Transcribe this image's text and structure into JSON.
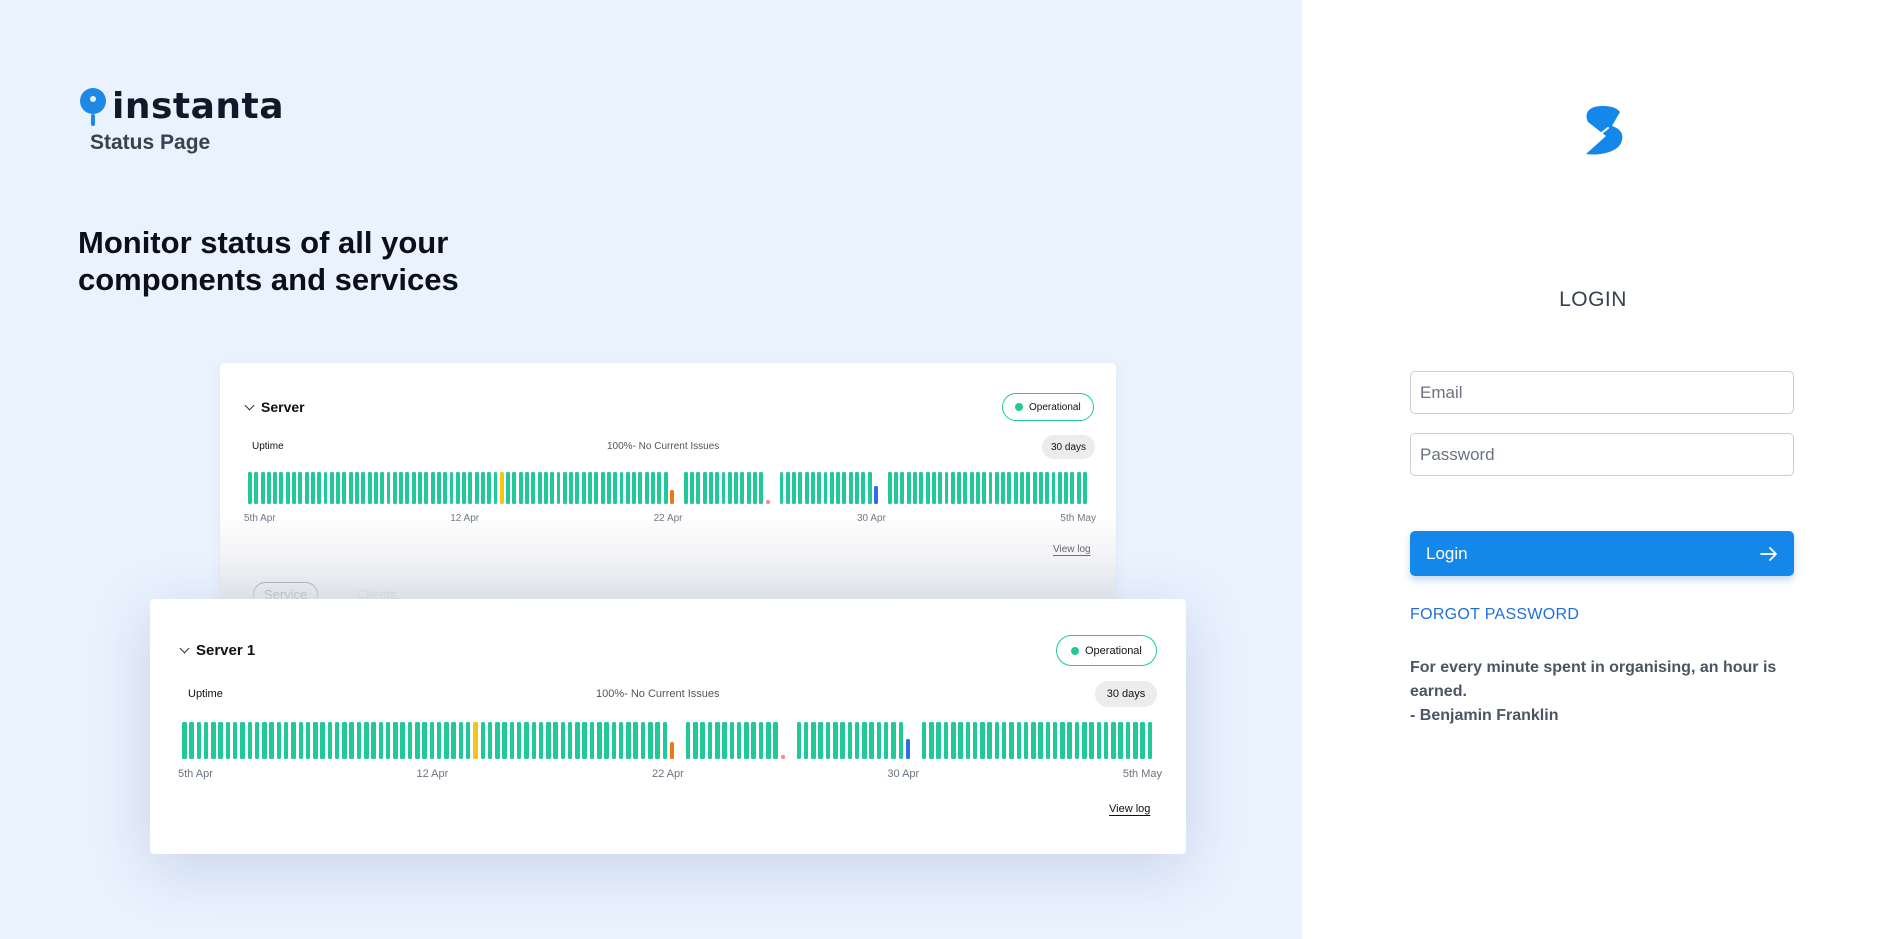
{
  "brand": {
    "name": "instanta",
    "subtitle": "Status Page"
  },
  "headline": "Monitor status of all your components and services",
  "preview_back": {
    "title": "Server",
    "status": "Operational",
    "uptime_label": "Uptime",
    "uptime_status": "100%- No Current  Issues",
    "range": "30 days",
    "axis": [
      "5th Apr",
      "12 Apr",
      "22 Apr",
      "30 Apr",
      "5th May"
    ],
    "view_log": "View log",
    "tabs": [
      "Service",
      "Clients"
    ]
  },
  "preview_front": {
    "title": "Server 1",
    "status": "Operational",
    "uptime_label": "Uptime",
    "uptime_status": "100%- No Current  Issues",
    "range": "30 days",
    "axis": [
      "5th Apr",
      "12 Apr",
      "22 Apr",
      "30 Apr",
      "5th May"
    ],
    "view_log": "View log"
  },
  "uptime_bars": {
    "count": 130,
    "colors": {
      "up": "#20c997",
      "degraded": "#f5c518",
      "partial": "#ea7a16",
      "outage": "#ff8a8a",
      "maintenance": "#2f6ee6"
    },
    "incidents": [
      {
        "index": 40,
        "status": "degraded",
        "level": 1.0
      },
      {
        "index": 67,
        "status": "partial",
        "level": 0.45
      },
      {
        "index": 81,
        "status": "outage",
        "level": 0.12
      },
      {
        "index": 97,
        "status": "maintenance",
        "level": 0.55
      }
    ],
    "gaps_after": [
      67,
      81,
      97
    ]
  },
  "login": {
    "title": "LOGIN",
    "email_placeholder": "Email",
    "password_placeholder": "Password",
    "button_label": "Login",
    "forgot_label": "FORGOT PASSWORD",
    "quote_line1": "For every minute spent in organising, an hour is earned.",
    "quote_line2": "- Benjamin Franklin"
  }
}
